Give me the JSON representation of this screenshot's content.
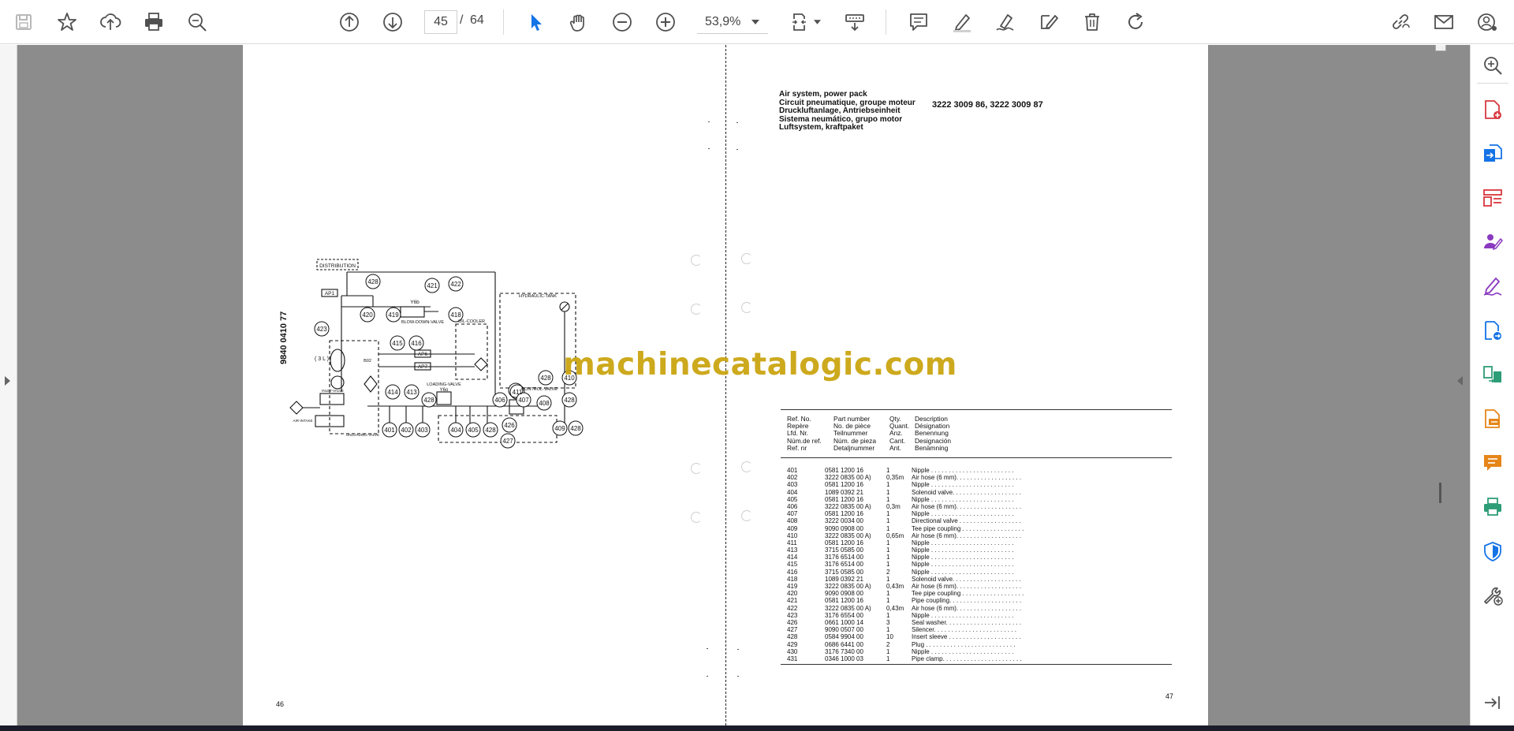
{
  "toolbar": {
    "page_current": "45",
    "page_separator": "/",
    "page_total": "64",
    "zoom": "53,9%",
    "icons": [
      "save-icon",
      "star-icon",
      "cloud-upload-icon",
      "print-icon",
      "search-icon",
      "page-up-icon",
      "page-down-icon",
      "select-arrow-icon",
      "hand-icon",
      "zoom-out-icon",
      "zoom-in-icon",
      "page-fit-icon",
      "scroll-mode-icon",
      "comment-icon",
      "highlight-icon",
      "draw-icon",
      "edit-icon",
      "delete-icon",
      "rotate-icon",
      "share-link-icon",
      "email-icon",
      "account-icon"
    ]
  },
  "document": {
    "left_page": {
      "page_number": "46",
      "diagram_code": "9840 0410 77",
      "diagram_labels": {
        "distribution": "DISTRIBUTION",
        "ap1": "AP1",
        "ap6": "AP6",
        "ap7": "AP7",
        "y6b": "Y6b",
        "blow_down_valve": "BLOW-DOWN-VALVE",
        "oil_cooler": "OIL-COOLER",
        "hydraulic_tank": "HYDRAULIC-TANK",
        "loading_valve": "LOADING-VALVE",
        "y60": "Y6o",
        "control_valve": "CONTROL-VALVE",
        "inlet_valve": "INLET-VALVE",
        "unloading_valve": "UNLOADING-VALVE",
        "air_intake": "AIR-INTAKE",
        "tank_3l": "( 3 L )",
        "b02": "B02",
        "callouts": [
          "428",
          "421",
          "422",
          "420",
          "419",
          "418",
          "423",
          "415",
          "416",
          "411",
          "428",
          "410",
          "414",
          "413",
          "428",
          "406",
          "428",
          "407",
          "408",
          "428",
          "401",
          "402",
          "403",
          "404",
          "405",
          "428",
          "426",
          "427",
          "409",
          "428"
        ]
      }
    },
    "right_page": {
      "page_number": "47",
      "title_lines": [
        "Air system, power pack",
        "Circuit pneumatique, groupe moteur",
        "Druckluftanlage, Antriebseinheit",
        "Sistema neumático, grupo motor",
        "Luftsystem, kraftpaket"
      ],
      "part_numbers": "3222 3009 86, 3222 3009 87",
      "table_headers": {
        "ref": [
          "Ref. No.",
          "Repère",
          "Lfd. Nr.",
          "Núm.de ref.",
          "Ref. nr"
        ],
        "part": [
          "Part number",
          "No. de pièce",
          "Teilnummer",
          "Núm. de pieza",
          "Detaljnummer"
        ],
        "qty": [
          "Qty.",
          "Quant.",
          "Anz.",
          "Cant.",
          "Ant."
        ],
        "desc": [
          "Description",
          "Désignation",
          "Benennung",
          "Designación",
          "Benämning"
        ]
      },
      "rows": [
        {
          "ref": "401",
          "part": "0581 1200 16",
          "qty": "1",
          "desc": "Nipple . . . . . . . . . . . . . . . . . . . . . . . ."
        },
        {
          "ref": "402",
          "part": "3222 0835 00 A)",
          "qty": "0,35m",
          "desc": "Air hose (6 mm). . . . . . . . . . . . . . . . . . ."
        },
        {
          "ref": "403",
          "part": "0581 1200 16",
          "qty": "1",
          "desc": "Nipple . . . . . . . . . . . . . . . . . . . . . . . ."
        },
        {
          "ref": "404",
          "part": "1089 0392 21",
          "qty": "1",
          "desc": "Solenoid valve. . . . . . . . . . . . . . . . . . . ."
        },
        {
          "ref": "405",
          "part": "0581 1200 16",
          "qty": "1",
          "desc": "Nipple . . . . . . . . . . . . . . . . . . . . . . . ."
        },
        {
          "ref": "406",
          "part": "3222 0835 00 A)",
          "qty": "0,3m",
          "desc": "Air hose (6 mm). . . . . . . . . . . . . . . . . . ."
        },
        {
          "ref": "407",
          "part": "0581 1200 16",
          "qty": "1",
          "desc": "Nipple . . . . . . . . . . . . . . . . . . . . . . . ."
        },
        {
          "ref": "408",
          "part": "3222 0034 00",
          "qty": "1",
          "desc": "Directional valve . . . . . . . . . . . . . . . . . ."
        },
        {
          "ref": "409",
          "part": "9090 0908 00",
          "qty": "1",
          "desc": "Tee pipe coupling . . . . . . . . . . . . . . . . . ."
        },
        {
          "ref": "410",
          "part": "3222 0835 00 A)",
          "qty": "0,65m",
          "desc": "Air hose (6 mm). . . . . . . . . . . . . . . . . . ."
        },
        {
          "ref": "411",
          "part": "0581 1200 16",
          "qty": "1",
          "desc": "Nipple . . . . . . . . . . . . . . . . . . . . . . . ."
        },
        {
          "ref": "413",
          "part": "3715 0585 00",
          "qty": "1",
          "desc": "Nipple . . . . . . . . . . . . . . . . . . . . . . . ."
        },
        {
          "ref": "414",
          "part": "3176 6514 00",
          "qty": "1",
          "desc": "Nipple . . . . . . . . . . . . . . . . . . . . . . . ."
        },
        {
          "ref": "415",
          "part": "3176 6514 00",
          "qty": "1",
          "desc": "Nipple . . . . . . . . . . . . . . . . . . . . . . . ."
        },
        {
          "ref": "416",
          "part": "3715 0585 00",
          "qty": "2",
          "desc": "Nipple . . . . . . . . . . . . . . . . . . . . . . . ."
        },
        {
          "ref": "418",
          "part": "1089 0392 21",
          "qty": "1",
          "desc": "Solenoid valve. . . . . . . . . . . . . . . . . . . ."
        },
        {
          "ref": "419",
          "part": "3222 0835 00 A)",
          "qty": "0,43m",
          "desc": "Air hose (6 mm). . . . . . . . . . . . . . . . . . ."
        },
        {
          "ref": "420",
          "part": "9090 0908 00",
          "qty": "1",
          "desc": "Tee pipe coupling . . . . . . . . . . . . . . . . . ."
        },
        {
          "ref": "421",
          "part": "0581 1200 16",
          "qty": "1",
          "desc": "Pipe coupling. . . . . . . . . . . . . . . . . . . . ."
        },
        {
          "ref": "422",
          "part": "3222 0835 00 A)",
          "qty": "0,43m",
          "desc": "Air hose (6 mm). . . . . . . . . . . . . . . . . . ."
        },
        {
          "ref": "423",
          "part": "3176 6554 00",
          "qty": "1",
          "desc": "Nipple . . . . . . . . . . . . . . . . . . . . . . . ."
        },
        {
          "ref": "426",
          "part": "0661 1000 14",
          "qty": "3",
          "desc": "Seal washer. . . . . . . . . . . . . . . . . . . . . ."
        },
        {
          "ref": "427",
          "part": "9090 0507 00",
          "qty": "1",
          "desc": "Silencer. . . . . . . . . . . . . . . . . . . . . . . ."
        },
        {
          "ref": "428",
          "part": "0584 9904 00",
          "qty": "10",
          "desc": "Insert sleeve . . . . . . . . . . . . . . . . . . . . ."
        },
        {
          "ref": "429",
          "part": "0686 6441 00",
          "qty": "2",
          "desc": "Plug . . . . . . . . . . . . . . . . . . . . . . . . . ."
        },
        {
          "ref": "430",
          "part": "3176 7340 00",
          "qty": "1",
          "desc": "Nipple . . . . . . . . . . . . . . . . . . . . . . . ."
        },
        {
          "ref": "431",
          "part": "0346 1000 03",
          "qty": "1",
          "desc": "Pipe clamp. . . . . . . . . . . . . . . . . . . . . . ."
        }
      ]
    },
    "watermark": "machinecatalogic.com"
  },
  "side_panel": {
    "icons": [
      "zoom-panel-icon",
      "create-pdf-icon",
      "export-pdf-icon",
      "organize-pages-icon",
      "request-signature-icon",
      "fill-sign-icon",
      "send-for-review-icon",
      "compare-files-icon",
      "scan-ocr-icon",
      "comment-tool-icon",
      "print-production-icon",
      "protect-icon",
      "more-tools-icon",
      "expand-panel-icon"
    ]
  },
  "colors": {
    "accent": "#1473e6",
    "viewer_bg": "#8c8c8c",
    "watermark": "#c9a20a",
    "icon": "#505050",
    "side_pink": "#d7373f",
    "side_blue": "#1473e6",
    "side_purple": "#8a3ac0",
    "side_green": "#2d9d78",
    "side_orange": "#e68619"
  }
}
